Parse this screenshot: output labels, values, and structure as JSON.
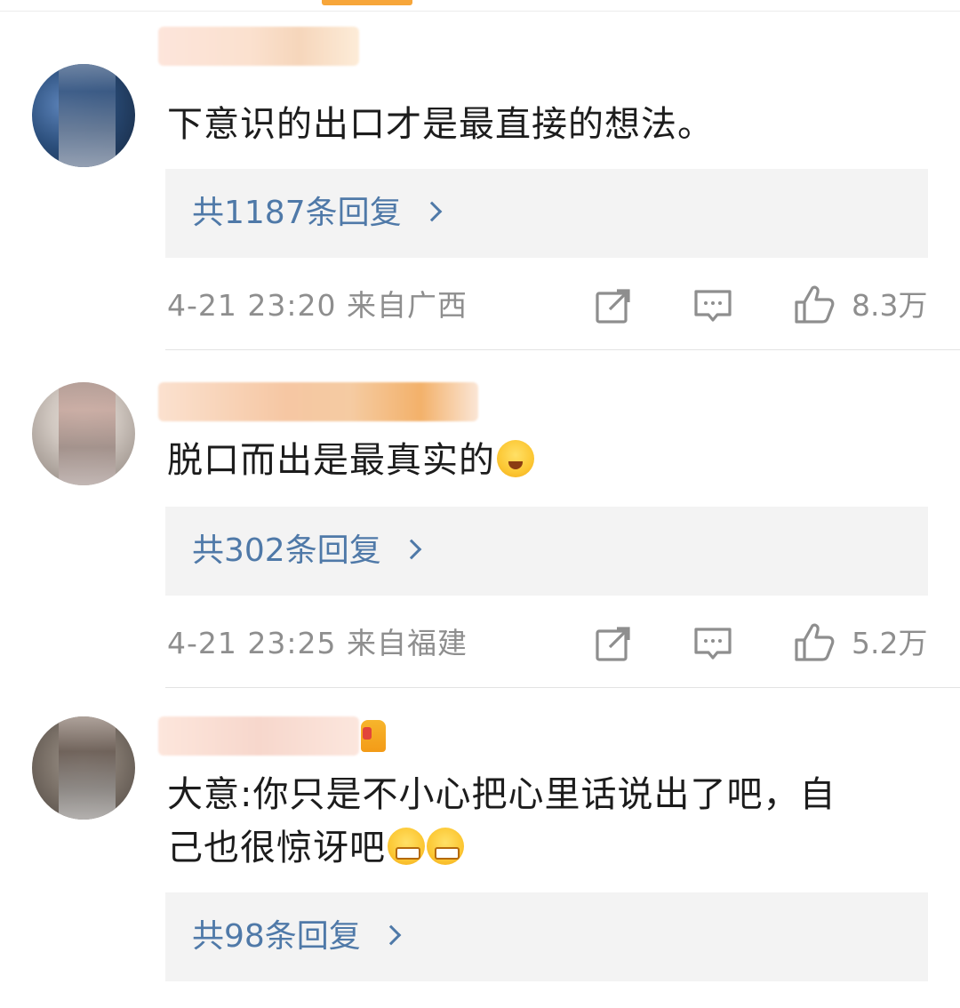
{
  "comments": [
    {
      "text": "下意识的出口才是最直接的想法。",
      "reply_label": "共1187条回复",
      "timestamp": "4-21 23:20",
      "location": "来自广西",
      "likes": "8.3万"
    },
    {
      "text": "脱口而出是最真实的",
      "reply_label": "共302条回复",
      "timestamp": "4-21 23:25",
      "location": "来自福建",
      "likes": "5.2万"
    },
    {
      "text_line1": "大意:你只是不小心把心里话说出了吧，自",
      "text_line2": "己也很惊讶吧",
      "reply_label": "共98条回复"
    }
  ],
  "icons": {
    "share": "share-icon",
    "comment": "comment-icon",
    "like": "thumbs-up-icon",
    "chevron": "chevron-right-icon",
    "emoji_blush": "blush-emoji-icon",
    "emoji_grin": "grin-emoji-icon",
    "badge": "fan-badge-icon"
  },
  "colors": {
    "link": "#4f79a8",
    "meta": "#8e8e8e",
    "reply_bg": "#f3f3f3",
    "accent": "#f7a63a"
  }
}
